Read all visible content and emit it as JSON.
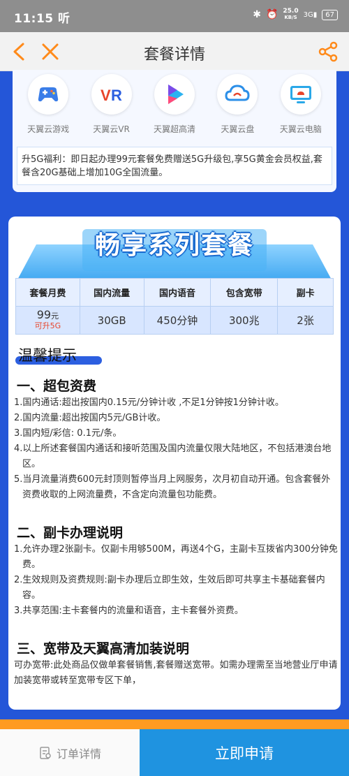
{
  "statusbar": {
    "time": "11:15",
    "time_suffix": "听",
    "speed_value": "25.0",
    "speed_unit": "KB/S",
    "network": "3G",
    "battery": "67"
  },
  "nav": {
    "title": "套餐详情"
  },
  "apps": [
    {
      "label": "天翼云游戏",
      "icon": "gamepad-icon"
    },
    {
      "label": "天翼云VR",
      "icon": "vr-icon"
    },
    {
      "label": "天翼超高清",
      "icon": "play-icon"
    },
    {
      "label": "天翼云盘",
      "icon": "cloud-drive-icon"
    },
    {
      "label": "天翼云电脑",
      "icon": "cloud-pc-icon"
    }
  ],
  "benefit": "升5G福利：即日起办理99元套餐免费赠送5G升级包,享5G黄金会员权益,套餐含20G基础上增加10G全国流量。",
  "banner_title": "畅享系列套餐",
  "table": {
    "headers": [
      "套餐月费",
      "国内流量",
      "国内语音",
      "包含宽带",
      "副卡"
    ],
    "row": {
      "price_value": "99",
      "price_unit": "元",
      "upgrade": "可升5G",
      "data": "30GB",
      "voice": "450分钟",
      "broadband": "300兆",
      "sub_card": "2张"
    }
  },
  "tips_title": "温馨提示",
  "sections": [
    {
      "title": "一、超包资费",
      "lines": [
        "1.国内通话:超出按国内0.15元/分钟计收 ,不足1分钟按1分钟计收。",
        "2.国内流量:超出按国内5元/GB计收。",
        "3.国内短/彩信: 0.1元/条。",
        "4.以上所述套餐国内通话和接听范围及国内流量仅限大陆地区，不包括港澳台地区。",
        "5.当月流量消费600元封顶则暂停当月上网服务，次月初自动开通。包含套餐外资费收取的上网流量费，不含定向流量包功能费。"
      ]
    },
    {
      "title": "二、副卡办理说明",
      "lines": [
        "1.允许办理2张副卡。仅副卡用够500M，再送4个G，主副卡互拨省内300分钟免费。",
        "2.生效规则及资费规则:副卡办理后立即生效，生效后即可共享主卡基础套餐内容。",
        "3.共享范围:主卡套餐内的流量和语音，主卡套餐外资费。"
      ]
    },
    {
      "title": "三、宽带及天翼高清加装说明",
      "lines": [
        "可办宽带:此处商品仅做单套餐销售,套餐赠送宽带。如需办理需至当地营业厅申请加装宽带或转至宽带专区下单，"
      ]
    }
  ],
  "bottom": {
    "order_label": "订单详情",
    "apply_label": "立即申请"
  },
  "colors": {
    "page_bg": "#2456d8",
    "accent": "#1f93e0",
    "orange": "#ff9b21",
    "table_bg": "#d8e6ff"
  }
}
